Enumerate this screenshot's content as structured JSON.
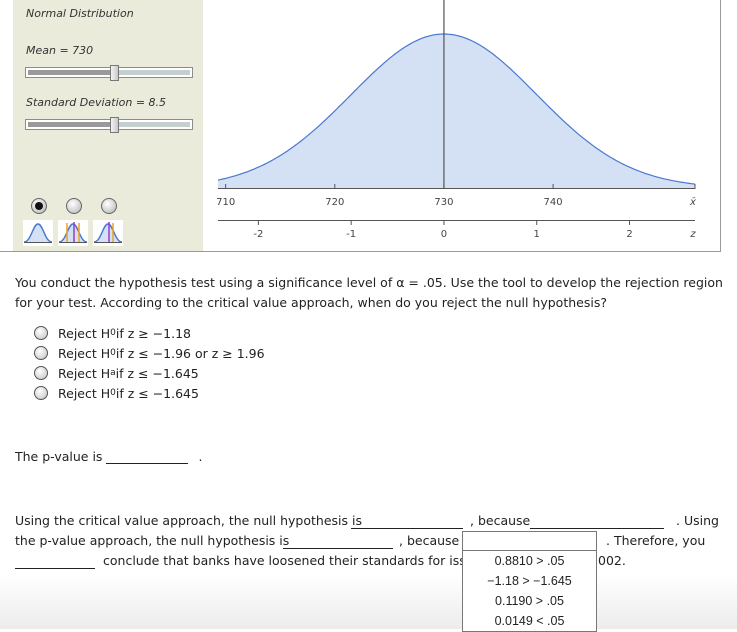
{
  "tool": {
    "title": "Normal Distribution",
    "mean_label": "Mean = 730",
    "sd_label": "Standard Deviation = 8.5",
    "mean_slider_fraction": 0.52,
    "sd_slider_fraction": 0.52,
    "graph_modes": [
      {
        "name": "no-tails",
        "selected": true
      },
      {
        "name": "two-tail",
        "selected": false
      },
      {
        "name": "one-tail",
        "selected": false
      }
    ],
    "colors": {
      "curve": "#4a78d0",
      "fill": "#d4e0f4",
      "panel": "#ebebdc",
      "tail_line_orange": "#f0a020",
      "center_line_purple": "#9a3cc8"
    }
  },
  "chart_data": {
    "type": "area",
    "title": "Normal Distribution",
    "mean": 730,
    "sd": 8.5,
    "x_range": [
      709.3,
      753
    ],
    "x_axis": {
      "label": "x̄",
      "ticks": [
        710,
        720,
        730,
        740
      ],
      "tick_labels": [
        "710",
        "720",
        "730",
        "740"
      ]
    },
    "z_axis": {
      "label": "z",
      "ticks": [
        -2,
        -1,
        0,
        1,
        2
      ],
      "tick_labels": [
        "-2",
        "-1",
        "0",
        "1",
        "2"
      ]
    },
    "center_line": 730,
    "grid": false
  },
  "question": {
    "text": "You conduct the hypothesis test using a significance level of α = .05. Use the tool to develop the rejection region for your test. According to the critical value approach, when do you reject the null hypothesis?",
    "options": [
      {
        "pre": "Reject H",
        "sub": "0",
        "post": " if z ≥ −1.18"
      },
      {
        "pre": "Reject H",
        "sub": "0",
        "post": " if z ≤ −1.96 or z ≥ 1.96"
      },
      {
        "pre": "Reject H",
        "sub": "a",
        "post": " if z ≤ −1.645"
      },
      {
        "pre": "Reject H",
        "sub": "0",
        "post": " if z ≤ −1.645"
      }
    ]
  },
  "pvalue": {
    "prefix": "The p-value is",
    "value": "",
    "suffix": "."
  },
  "conclusion": {
    "line1_a": "Using the critical value approach, the null hypothesis is",
    "line1_b": ", because",
    "line1_c": ". Using",
    "line2_a": "the p-value approach, the null hypothesis is",
    "line2_b": ", because",
    "line2_c": ". Therefore, you",
    "line3_a": "conclude that banks have loosened their standards for issui",
    "line3_b": "002."
  },
  "dropdown": {
    "value": "",
    "options": [
      "0.8810 > .05",
      "−1.18 > −1.645",
      "0.1190 > .05",
      "0.0149 < .05"
    ]
  }
}
